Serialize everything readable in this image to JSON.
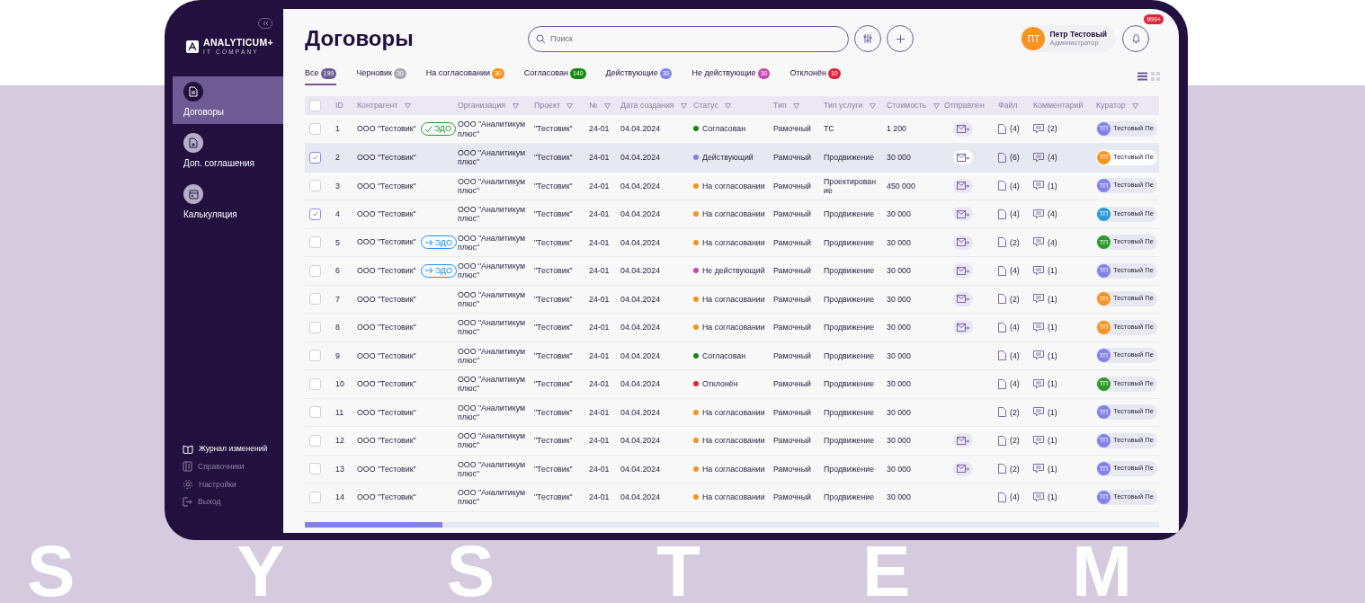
{
  "backdrop": {
    "word": "SYSTEM"
  },
  "sidebar": {
    "logo": {
      "name": "ANALYTICUM+",
      "tagline": "IT COMPANY"
    },
    "items": [
      {
        "kind": "contracts",
        "label": "Договоры",
        "selected": true
      },
      {
        "kind": "agreements",
        "label": "Доп. соглашения",
        "selected": false
      },
      {
        "kind": "calculation",
        "label": "Калькуляция",
        "selected": false
      }
    ],
    "footer": [
      {
        "kind": "changelog",
        "label": "Журнал изменений",
        "active": true
      },
      {
        "kind": "directory",
        "label": "Справочники",
        "active": false
      },
      {
        "kind": "settings",
        "label": "Настройки",
        "active": false
      },
      {
        "kind": "logout",
        "label": "Выход",
        "active": false
      }
    ]
  },
  "header": {
    "title": "Договоры",
    "search": {
      "placeholder": "Поиск"
    },
    "user": {
      "initials": "ПТ",
      "name": "Петр Тестовый",
      "role": "Администратор"
    },
    "notifications": "999+"
  },
  "tabs": [
    {
      "label": "Все",
      "count": "199",
      "color": "#6c5a9a",
      "selected": true
    },
    {
      "label": "Черновик",
      "count": "30",
      "color": "#a9a9b2",
      "selected": false
    },
    {
      "label": "На согласовании",
      "count": "30",
      "color": "#f7931e",
      "selected": false
    },
    {
      "label": "Согласован",
      "count": "140",
      "color": "#16880f",
      "selected": false
    },
    {
      "label": "Действующие",
      "count": "30",
      "color": "#8282ea",
      "selected": false
    },
    {
      "label": "Не действующие",
      "count": "30",
      "color": "#c948b4",
      "selected": false
    },
    {
      "label": "Отклонён",
      "count": "10",
      "color": "#e0243a",
      "selected": false
    }
  ],
  "view_toggle": [
    {
      "kind": "list",
      "selected": true
    },
    {
      "kind": "grid",
      "selected": false
    }
  ],
  "table": {
    "all_checked": false,
    "columns": [
      {
        "label": "ID",
        "filter": false
      },
      {
        "label": "Контрагент",
        "filter": true
      },
      {
        "label": "Организация",
        "filter": true
      },
      {
        "label": "Проект",
        "filter": true
      },
      {
        "label": "№",
        "filter": true
      },
      {
        "label": "Дата создания",
        "filter": true
      },
      {
        "label": "Статус",
        "filter": true
      },
      {
        "label": "Тип",
        "filter": true
      },
      {
        "label": "Тип услуги",
        "filter": true
      },
      {
        "label": "Стоимость",
        "filter": true
      },
      {
        "label": "Отправлен",
        "filter": false
      },
      {
        "label": "Файл",
        "filter": false
      },
      {
        "label": "Комментарий",
        "filter": false
      },
      {
        "label": "Куратор",
        "filter": true
      }
    ],
    "rows": [
      {
        "checked": false,
        "selected": false,
        "id": "1",
        "counterparty": "ООО \"Тестовик\"",
        "edo": {
          "kind": "signed",
          "label": "ЭДО"
        },
        "organization": "ООО \"Аналитикум плюс\"",
        "project": "\"Тестовик\"",
        "number": "24-01",
        "date": "04.04.2024",
        "status": {
          "label": "Согласован",
          "color": "#16880f"
        },
        "type": "Рамочный",
        "service": "ТС",
        "cost": "1 200",
        "sent": true,
        "files": "(4)",
        "comments": "(2)",
        "curator": {
          "initials": "ТП",
          "name": "Тестовый Пе",
          "color": "#8282ea"
        }
      },
      {
        "checked": true,
        "selected": true,
        "id": "2",
        "counterparty": "ООО \"Тестовик\"",
        "organization": "ООО \"Аналитикум плюс\"",
        "project": "\"Тестовик\"",
        "number": "24-01",
        "date": "04.04.2024",
        "status": {
          "label": "Действующий",
          "color": "#8282ea"
        },
        "type": "Рамочный",
        "service": "Продвижение",
        "cost": "30 000",
        "sent": true,
        "files": "(6)",
        "comments": "(4)",
        "curator": {
          "initials": "ТП",
          "name": "Тестовый Пе",
          "color": "#f7931e"
        }
      },
      {
        "checked": false,
        "selected": false,
        "id": "3",
        "counterparty": "ООО \"Тестовик\"",
        "organization": "ООО \"Аналитикум плюс\"",
        "project": "\"Тестовик\"",
        "number": "24-01",
        "date": "04.04.2024",
        "status": {
          "label": "На согласовании",
          "color": "#f7931e"
        },
        "type": "Рамочный",
        "service": "Проектирование",
        "cost": "450 000",
        "sent": true,
        "files": "(4)",
        "comments": "(1)",
        "curator": {
          "initials": "ТП",
          "name": "Тестовый Пе",
          "color": "#8282ea"
        }
      },
      {
        "checked": true,
        "selected": false,
        "id": "4",
        "counterparty": "ООО \"Тестовик\"",
        "organization": "ООО \"Аналитикум плюс\"",
        "project": "\"Тестовик\"",
        "number": "24-01",
        "date": "04.04.2024",
        "status": {
          "label": "На согласовании",
          "color": "#f7931e"
        },
        "type": "Рамочный",
        "service": "Продвижение",
        "cost": "30 000",
        "sent": true,
        "files": "(4)",
        "comments": "(4)",
        "curator": {
          "initials": "ТП",
          "name": "Тестовый Пе",
          "color": "#2f9bd6"
        }
      },
      {
        "checked": false,
        "selected": false,
        "id": "5",
        "counterparty": "ООО \"Тестовик\"",
        "edo": {
          "kind": "sent",
          "label": "ЭДО"
        },
        "organization": "ООО \"Аналитикум плюс\"",
        "project": "\"Тестовик\"",
        "number": "24-01",
        "date": "04.04.2024",
        "status": {
          "label": "На согласовании",
          "color": "#f7931e"
        },
        "type": "Рамочный",
        "service": "Продвижение",
        "cost": "30 000",
        "sent": true,
        "files": "(2)",
        "comments": "(4)",
        "curator": {
          "initials": "ТП",
          "name": "Тестовый Пе",
          "color": "#2a9a2a"
        }
      },
      {
        "checked": false,
        "selected": false,
        "id": "6",
        "counterparty": "ООО \"Тестовик\"",
        "edo": {
          "kind": "sent",
          "label": "ЭДО"
        },
        "organization": "ООО \"Аналитикум плюс\"",
        "project": "\"Тестовик\"",
        "number": "24-01",
        "date": "04.04.2024",
        "status": {
          "label": "Не действующий",
          "color": "#c948b4"
        },
        "type": "Рамочный",
        "service": "Продвижение",
        "cost": "30 000",
        "sent": true,
        "files": "(4)",
        "comments": "(1)",
        "curator": {
          "initials": "ТП",
          "name": "Тестовый Пе",
          "color": "#8282ea"
        }
      },
      {
        "checked": false,
        "selected": false,
        "id": "7",
        "counterparty": "ООО \"Тестовик\"",
        "organization": "ООО \"Аналитикум плюс\"",
        "project": "\"Тестовик\"",
        "number": "24-01",
        "date": "04.04.2024",
        "status": {
          "label": "На согласовании",
          "color": "#f7931e"
        },
        "type": "Рамочный",
        "service": "Продвижение",
        "cost": "30 000",
        "sent": true,
        "files": "(2)",
        "comments": "(1)",
        "curator": {
          "initials": "ТП",
          "name": "Тестовый Пе",
          "color": "#f7931e"
        }
      },
      {
        "checked": false,
        "selected": false,
        "id": "8",
        "counterparty": "ООО \"Тестовик\"",
        "organization": "ООО \"Аналитикум плюс\"",
        "project": "\"Тестовик\"",
        "number": "24-01",
        "date": "04.04.2024",
        "status": {
          "label": "На согласовании",
          "color": "#f7931e"
        },
        "type": "Рамочный",
        "service": "Продвижение",
        "cost": "30 000",
        "sent": true,
        "files": "(4)",
        "comments": "(1)",
        "curator": {
          "initials": "ТП",
          "name": "Тестовый Пе",
          "color": "#f7931e"
        }
      },
      {
        "checked": false,
        "selected": false,
        "id": "9",
        "counterparty": "ООО \"Тестовик\"",
        "organization": "ООО \"Аналитикум плюс\"",
        "project": "\"Тестовик\"",
        "number": "24-01",
        "date": "04.04.2024",
        "status": {
          "label": "Согласован",
          "color": "#16880f"
        },
        "type": "Рамочный",
        "service": "Продвижение",
        "cost": "30 000",
        "sent": false,
        "files": "(4)",
        "comments": "(1)",
        "curator": {
          "initials": "ТП",
          "name": "Тестовый Пе",
          "color": "#8282ea"
        }
      },
      {
        "checked": false,
        "selected": false,
        "id": "10",
        "counterparty": "ООО \"Тестовик\"",
        "organization": "ООО \"Аналитикум плюс\"",
        "project": "\"Тестовик\"",
        "number": "24-01",
        "date": "04.04.2024",
        "status": {
          "label": "Отклонён",
          "color": "#e0243a"
        },
        "type": "Рамочный",
        "service": "Продвижение",
        "cost": "30 000",
        "sent": false,
        "files": "(4)",
        "comments": "(1)",
        "curator": {
          "initials": "ТП",
          "name": "Тестовый Пе",
          "color": "#2a9a2a"
        }
      },
      {
        "checked": false,
        "selected": false,
        "id": "11",
        "counterparty": "ООО \"Тестовик\"",
        "organization": "ООО \"Аналитикум плюс\"",
        "project": "\"Тестовик\"",
        "number": "24-01",
        "date": "04.04.2024",
        "status": {
          "label": "На согласовании",
          "color": "#f7931e"
        },
        "type": "Рамочный",
        "service": "Продвижение",
        "cost": "30 000",
        "sent": false,
        "files": "(2)",
        "comments": "(1)",
        "curator": {
          "initials": "ТП",
          "name": "Тестовый Пе",
          "color": "#8282ea"
        }
      },
      {
        "checked": false,
        "selected": false,
        "id": "12",
        "counterparty": "ООО \"Тестовик\"",
        "organization": "ООО \"Аналитикум плюс\"",
        "project": "\"Тестовик\"",
        "number": "24-01",
        "date": "04.04.2024",
        "status": {
          "label": "На согласовании",
          "color": "#f7931e"
        },
        "type": "Рамочный",
        "service": "Продвижение",
        "cost": "30 000",
        "sent": true,
        "files": "(2)",
        "comments": "(1)",
        "curator": {
          "initials": "ТП",
          "name": "Тестовый Пе",
          "color": "#8282ea"
        }
      },
      {
        "checked": false,
        "selected": false,
        "id": "13",
        "counterparty": "ООО \"Тестовик\"",
        "organization": "ООО \"Аналитикум плюс\"",
        "project": "\"Тестовик\"",
        "number": "24-01",
        "date": "04.04.2024",
        "status": {
          "label": "На согласовании",
          "color": "#f7931e"
        },
        "type": "Рамочный",
        "service": "Продвижение",
        "cost": "30 000",
        "sent": true,
        "files": "(2)",
        "comments": "(1)",
        "curator": {
          "initials": "ТП",
          "name": "Тестовый Пе",
          "color": "#8282ea"
        }
      },
      {
        "checked": false,
        "selected": false,
        "id": "14",
        "counterparty": "ООО \"Тестовик\"",
        "organization": "ООО \"Аналитикум плюс\"",
        "project": "\"Тестовик\"",
        "number": "24-01",
        "date": "04.04.2024",
        "status": {
          "label": "На согласовании",
          "color": "#f7931e"
        },
        "type": "Рамочный",
        "service": "Продвижение",
        "cost": "30 000",
        "sent": false,
        "files": "(4)",
        "comments": "(1)",
        "curator": {
          "initials": "ТП",
          "name": "Тестовый Пе",
          "color": "#8282ea"
        }
      }
    ]
  }
}
